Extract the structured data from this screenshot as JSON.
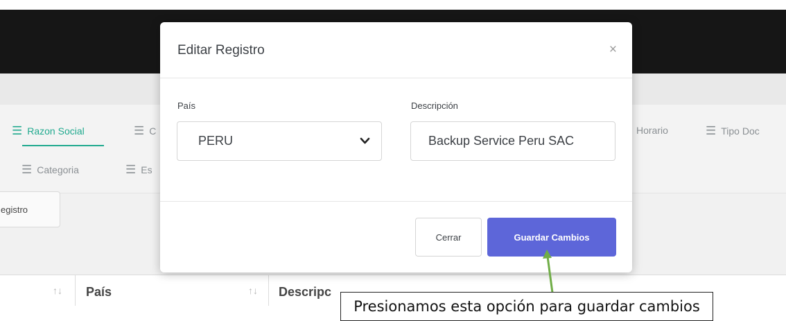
{
  "background": {
    "tabs": {
      "row1": [
        {
          "label": "Razon Social",
          "active": true
        },
        {
          "label": "C",
          "active": false
        },
        {
          "label": "Horario",
          "active": false
        },
        {
          "label": "Tipo Doc",
          "active": false
        }
      ],
      "row2": [
        {
          "label": "Categoria",
          "active": false
        },
        {
          "label": "Es",
          "active": false
        }
      ]
    },
    "register_button_label": "egistro",
    "table_headers": [
      "País",
      "Descripc"
    ]
  },
  "modal": {
    "title": "Editar Registro",
    "close_symbol": "×",
    "fields": {
      "country_label": "País",
      "country_value": "PERU",
      "description_label": "Descripción",
      "description_value": "Backup Service Peru SAC"
    },
    "buttons": {
      "close": "Cerrar",
      "save": "Guardar Cambios"
    }
  },
  "annotation": {
    "text": "Presionamos esta opción para guardar cambios"
  },
  "colors": {
    "accent_green": "#1fa98e",
    "primary_button": "#5d66d9",
    "topbar": "#161616",
    "arrow": "#70ad47"
  }
}
